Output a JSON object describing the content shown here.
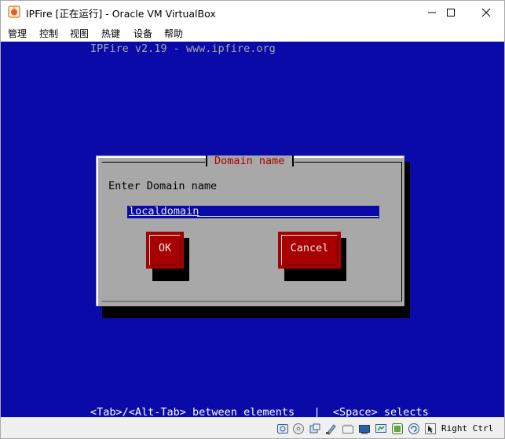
{
  "window": {
    "title": "IPFire [正在运行] - Oracle VM VirtualBox",
    "controls": [
      "minimize",
      "maximize",
      "close"
    ]
  },
  "menubar": {
    "items": [
      "管理",
      "控制",
      "视图",
      "热键",
      "设备",
      "帮助"
    ]
  },
  "console": {
    "banner": "IPFire v2.19 - www.ipfire.org",
    "footer": "<Tab>/<Alt-Tab> between elements   |  <Space> selects"
  },
  "dialog": {
    "title": "Domain name",
    "prompt": "Enter Domain name",
    "input_value": "localdomain",
    "ok_label": "OK",
    "cancel_label": "Cancel"
  },
  "statusbar": {
    "icons": [
      "hard-disk-icon",
      "optical-drive-icon",
      "audio-icon",
      "network-icon",
      "usb-icon",
      "shared-folders-icon",
      "display-icon",
      "video-capture-icon",
      "cpu-icon",
      "mouse-integration-icon",
      "keyboard-icon"
    ],
    "host_key": "Right Ctrl"
  },
  "colors": {
    "console_bg": "#0a0aa8",
    "dialog_bg": "#a8a8a8",
    "button_bg": "#a80000",
    "title_red": "#a80000"
  }
}
